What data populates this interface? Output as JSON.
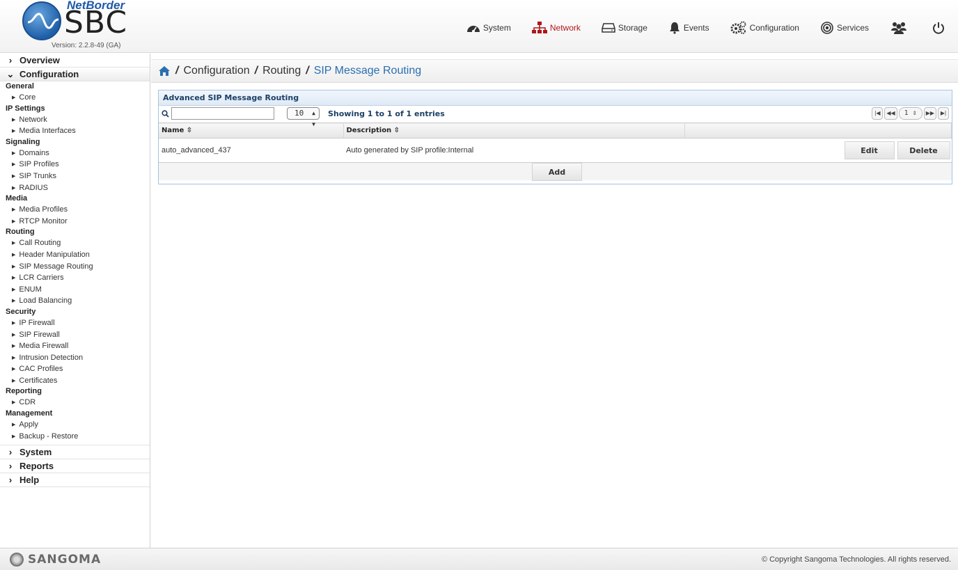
{
  "header": {
    "brand": "NetBorder",
    "product": "SBC",
    "version": "Version: 2.2.8-49 (GA)",
    "nav": [
      {
        "label": "System",
        "icon": "dashboard-icon"
      },
      {
        "label": "Network",
        "icon": "network-icon",
        "active": true
      },
      {
        "label": "Storage",
        "icon": "storage-icon"
      },
      {
        "label": "Events",
        "icon": "bell-icon"
      },
      {
        "label": "Configuration",
        "icon": "gears-icon"
      },
      {
        "label": "Services",
        "icon": "services-icon"
      }
    ],
    "accent_color": "#b0161c"
  },
  "sidebar": {
    "overview": "Overview",
    "configuration": "Configuration",
    "groups": [
      {
        "title": "General",
        "items": [
          "Core"
        ]
      },
      {
        "title": "IP Settings",
        "items": [
          "Network",
          "Media Interfaces"
        ]
      },
      {
        "title": "Signaling",
        "items": [
          "Domains",
          "SIP Profiles",
          "SIP Trunks",
          "RADIUS"
        ]
      },
      {
        "title": "Media",
        "items": [
          "Media Profiles",
          "RTCP Monitor"
        ]
      },
      {
        "title": "Routing",
        "items": [
          "Call Routing",
          "Header Manipulation",
          "SIP Message Routing",
          "LCR Carriers",
          "ENUM",
          "Load Balancing"
        ]
      },
      {
        "title": "Security",
        "items": [
          "IP Firewall",
          "SIP Firewall",
          "Media Firewall",
          "Intrusion Detection",
          "CAC Profiles",
          "Certificates"
        ]
      },
      {
        "title": "Reporting",
        "items": [
          "CDR"
        ]
      },
      {
        "title": "Management",
        "items": [
          "Apply",
          "Backup - Restore"
        ]
      }
    ],
    "system": "System",
    "reports": "Reports",
    "help": "Help"
  },
  "breadcrumb": {
    "c1": "Configuration",
    "c2": "Routing",
    "current": "SIP Message Routing"
  },
  "panel": {
    "title": "Advanced SIP Message Routing",
    "search_value": "",
    "page_size": "10",
    "info": "Showing 1 to 1 of 1 entries",
    "page": "1",
    "columns": {
      "name": "Name",
      "description": "Description"
    },
    "rows": [
      {
        "name": "auto_advanced_437",
        "description": "Auto generated by SIP profile:Internal"
      }
    ],
    "edit_label": "Edit",
    "delete_label": "Delete",
    "add_label": "Add"
  },
  "footer": {
    "logo": "SANGOMA",
    "copyright": "© Copyright Sangoma Technologies. All rights reserved."
  }
}
